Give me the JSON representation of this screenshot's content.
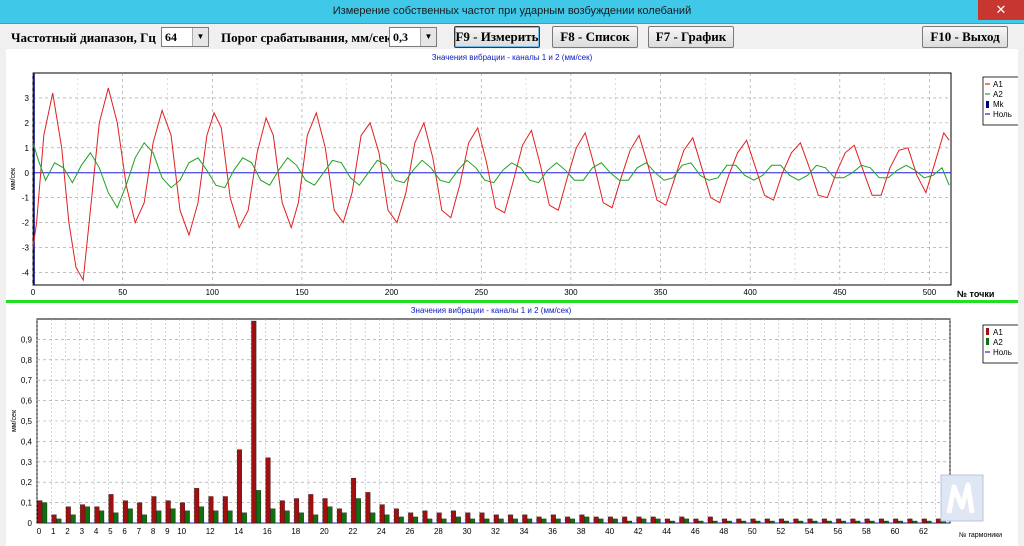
{
  "window": {
    "title": "Измерение собственных частот при ударным возбуждении колебаний",
    "close_label": "✕"
  },
  "toolbar": {
    "freq_label": "Частотный  диапазон, Гц",
    "freq_value": "64",
    "threshold_label": "Порог  срабатывания, мм/сек",
    "threshold_value": "0,3",
    "measure_button": "F9 - Измерить",
    "list_button": "F8 - Список",
    "graph_button": "F7 - График",
    "exit_button": "F10 - Выход"
  },
  "colors": {
    "a1": "#e02020",
    "a2": "#20a020",
    "mk": "#000080",
    "zero": "#2020e0",
    "bar_a1": "#a01010",
    "bar_a2": "#107010"
  },
  "chart_data": [
    {
      "type": "line",
      "title": "Значения вибрации  - каналы 1 и 2 (мм/сек)",
      "ylabel": "мм/сек",
      "xlabel": "№ точки",
      "xlim": [
        0,
        512
      ],
      "ylim": [
        -4.5,
        4.0
      ],
      "xticks": [
        0,
        50,
        100,
        150,
        200,
        250,
        300,
        350,
        400,
        450,
        500
      ],
      "yticks": [
        -4,
        -3,
        -2,
        -1,
        0,
        1,
        2,
        3
      ],
      "grid": true,
      "legend_position": "right",
      "legend": [
        "A1",
        "A2",
        "Mk",
        "Ноль"
      ],
      "series": [
        {
          "name": "A1",
          "x": [
            0,
            2,
            6,
            11,
            16,
            20,
            24,
            28,
            32,
            37,
            42,
            47,
            52,
            57,
            62,
            67,
            72,
            77,
            82,
            87,
            92,
            97,
            101,
            105,
            110,
            115,
            120,
            125,
            130,
            134,
            139,
            144,
            148,
            153,
            158,
            163,
            168,
            173,
            178,
            183,
            188,
            193,
            198,
            203,
            208,
            213,
            218,
            223,
            228,
            233,
            238,
            243,
            248,
            253,
            258,
            263,
            268,
            273,
            278,
            283,
            288,
            293,
            298,
            303,
            308,
            313,
            318,
            323,
            328,
            333,
            338,
            343,
            348,
            353,
            358,
            363,
            368,
            373,
            378,
            383,
            388,
            393,
            398,
            403,
            408,
            413,
            418,
            423,
            428,
            433,
            438,
            443,
            448,
            453,
            458,
            463,
            468,
            473,
            478,
            483,
            488,
            493,
            498,
            503,
            508,
            511
          ],
          "y": [
            -3.0,
            -2.0,
            1.5,
            3.2,
            1.0,
            -2.0,
            -3.8,
            -4.3,
            -1.5,
            2.0,
            3.4,
            2.0,
            -0.5,
            -2.0,
            -1.2,
            1.2,
            2.5,
            1.5,
            -1.5,
            -2.5,
            -1.2,
            1.5,
            2.4,
            1.8,
            -1.0,
            -2.2,
            -1.5,
            0.8,
            2.2,
            1.5,
            -1.2,
            -2.2,
            -1.2,
            1.5,
            2.4,
            1.0,
            -1.5,
            -2.0,
            -0.8,
            1.5,
            2.0,
            0.8,
            -1.5,
            -2.0,
            -0.8,
            1.2,
            2.0,
            0.6,
            -1.5,
            -1.8,
            -0.5,
            1.2,
            1.8,
            0.4,
            -1.4,
            -1.6,
            -0.3,
            1.1,
            1.7,
            0.3,
            -1.3,
            -1.5,
            -0.2,
            1.0,
            1.6,
            0.3,
            -1.2,
            -1.4,
            -0.2,
            0.9,
            1.5,
            0.3,
            -1.1,
            -1.3,
            -0.2,
            0.9,
            1.4,
            0.2,
            -1.0,
            -1.2,
            -0.1,
            0.8,
            1.3,
            0.2,
            -0.9,
            -1.1,
            0.0,
            0.8,
            1.2,
            0.2,
            -0.9,
            -1.0,
            0.0,
            0.8,
            1.1,
            0.1,
            -0.9,
            -0.9,
            0.2,
            0.9,
            1.0,
            -0.1,
            -0.8,
            0.4,
            1.6,
            1.3
          ]
        },
        {
          "name": "A2",
          "x": [
            0,
            3,
            7,
            12,
            17,
            22,
            27,
            32,
            37,
            42,
            47,
            52,
            57,
            62,
            67,
            72,
            77,
            82,
            87,
            92,
            97,
            102,
            107,
            112,
            117,
            122,
            127,
            132,
            137,
            142,
            147,
            152,
            157,
            162,
            167,
            172,
            177,
            182,
            187,
            192,
            197,
            202,
            207,
            212,
            217,
            222,
            227,
            232,
            237,
            242,
            247,
            252,
            257,
            262,
            267,
            272,
            277,
            282,
            287,
            292,
            297,
            302,
            307,
            312,
            317,
            322,
            327,
            332,
            337,
            342,
            347,
            352,
            357,
            362,
            367,
            372,
            377,
            382,
            387,
            392,
            397,
            402,
            407,
            412,
            417,
            422,
            427,
            432,
            437,
            442,
            447,
            452,
            457,
            462,
            467,
            472,
            477,
            482,
            487,
            492,
            497,
            502,
            507,
            511
          ],
          "y": [
            1.2,
            0.5,
            -0.3,
            0.4,
            0.2,
            -0.4,
            0.3,
            0.8,
            0.2,
            -0.8,
            -1.4,
            -0.5,
            0.6,
            1.2,
            0.8,
            -0.2,
            -0.6,
            -0.3,
            0.4,
            0.6,
            0.1,
            -0.5,
            -0.6,
            0.1,
            0.6,
            0.4,
            -0.3,
            -0.5,
            0.1,
            0.6,
            0.3,
            -0.3,
            -0.5,
            0.0,
            0.5,
            0.4,
            -0.2,
            -0.5,
            0.0,
            0.5,
            0.3,
            -0.3,
            -0.4,
            0.1,
            0.5,
            0.2,
            -0.3,
            -0.4,
            0.1,
            0.5,
            0.2,
            -0.3,
            -0.4,
            0.1,
            0.4,
            0.2,
            -0.3,
            -0.4,
            0.1,
            0.4,
            0.1,
            -0.3,
            -0.3,
            0.2,
            0.4,
            0.0,
            -0.3,
            -0.3,
            0.2,
            0.4,
            0.0,
            -0.3,
            -0.2,
            0.3,
            0.4,
            -0.1,
            -0.3,
            -0.2,
            0.3,
            0.3,
            -0.1,
            -0.3,
            -0.1,
            0.3,
            0.3,
            -0.1,
            -0.3,
            -0.1,
            0.3,
            0.2,
            -0.2,
            -0.2,
            0.0,
            0.3,
            0.2,
            -0.2,
            -0.2,
            0.1,
            0.3,
            0.1,
            -0.2,
            -0.1,
            0.2,
            -0.5
          ]
        }
      ]
    },
    {
      "type": "bar",
      "title": "Значения вибрации  - каналы 1 и 2 (мм/сек)",
      "ylabel": "мм/сек",
      "xlabel": "№ гармоники",
      "xlim": [
        0,
        64
      ],
      "ylim": [
        0,
        1.0
      ],
      "xticks": [
        0,
        1,
        2,
        3,
        4,
        5,
        6,
        7,
        8,
        9,
        10,
        12,
        14,
        16,
        18,
        20,
        22,
        24,
        26,
        28,
        30,
        32,
        34,
        36,
        38,
        40,
        42,
        44,
        46,
        48,
        50,
        52,
        54,
        56,
        58,
        60,
        62
      ],
      "yticks": [
        0,
        0.1,
        0.2,
        0.3,
        0.4,
        0.5,
        0.6,
        0.7,
        0.8,
        0.9
      ],
      "ytick_labels": [
        "0",
        "0,1",
        "0,2",
        "0,3",
        "0,4",
        "0,5",
        "0,6",
        "0,7",
        "0,8",
        "0,9"
      ],
      "grid": true,
      "legend_position": "right",
      "legend": [
        "A1",
        "A2",
        "Ноль"
      ],
      "series": [
        {
          "name": "A1",
          "values": [
            0.11,
            0.04,
            0.08,
            0.09,
            0.08,
            0.14,
            0.11,
            0.1,
            0.13,
            0.11,
            0.1,
            0.17,
            0.13,
            0.13,
            0.36,
            0.99,
            0.32,
            0.11,
            0.12,
            0.14,
            0.12,
            0.07,
            0.22,
            0.15,
            0.09,
            0.07,
            0.05,
            0.06,
            0.05,
            0.06,
            0.05,
            0.05,
            0.04,
            0.04,
            0.04,
            0.03,
            0.04,
            0.03,
            0.04,
            0.03,
            0.03,
            0.03,
            0.03,
            0.03,
            0.02,
            0.03,
            0.02,
            0.03,
            0.02,
            0.02,
            0.02,
            0.02,
            0.02,
            0.02,
            0.02,
            0.02,
            0.02,
            0.02,
            0.02,
            0.02,
            0.02,
            0.02,
            0.02,
            0.02
          ]
        },
        {
          "name": "A2",
          "values": [
            0.1,
            0.02,
            0.04,
            0.08,
            0.06,
            0.05,
            0.07,
            0.04,
            0.06,
            0.07,
            0.06,
            0.08,
            0.06,
            0.06,
            0.05,
            0.16,
            0.07,
            0.06,
            0.05,
            0.04,
            0.08,
            0.05,
            0.12,
            0.05,
            0.04,
            0.03,
            0.03,
            0.02,
            0.02,
            0.03,
            0.02,
            0.02,
            0.02,
            0.02,
            0.02,
            0.02,
            0.02,
            0.02,
            0.03,
            0.02,
            0.02,
            0.01,
            0.02,
            0.02,
            0.01,
            0.02,
            0.01,
            0.01,
            0.01,
            0.01,
            0.01,
            0.01,
            0.01,
            0.01,
            0.01,
            0.01,
            0.01,
            0.01,
            0.01,
            0.01,
            0.01,
            0.01,
            0.01,
            0.01
          ]
        }
      ]
    }
  ]
}
